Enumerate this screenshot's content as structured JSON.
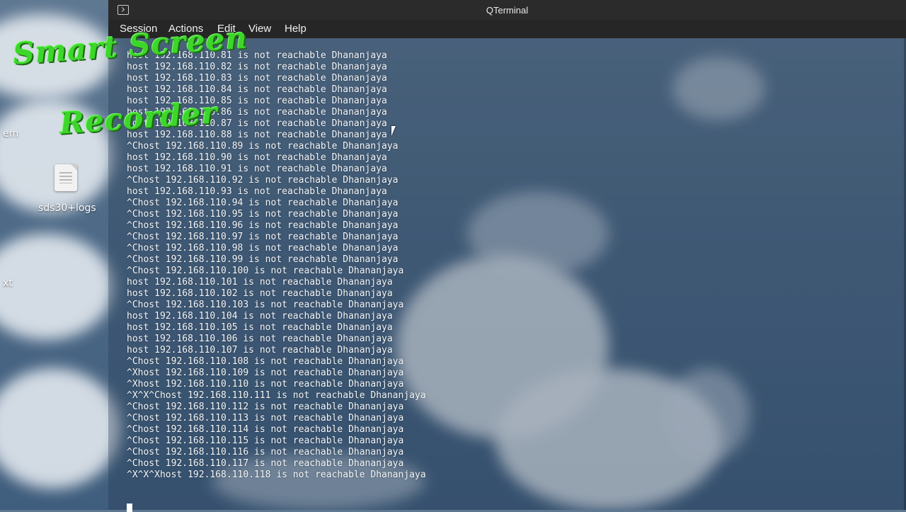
{
  "window": {
    "title": "QTerminal",
    "menu": [
      "Session",
      "Actions",
      "Edit",
      "View",
      "Help"
    ]
  },
  "desktop": {
    "icons": [
      {
        "label": "em",
        "icon": "partial-label"
      },
      {
        "label": "sds30+logs",
        "icon": "text-file-icon"
      },
      {
        "label": "xt",
        "icon": "partial-label"
      }
    ]
  },
  "watermark": {
    "line1": "Smart Screen",
    "line2": "Recorder"
  },
  "terminal": {
    "lines": [
      "host 192.168.110.81 is not reachable Dhananjaya",
      "host 192.168.110.82 is not reachable Dhananjaya",
      "host 192.168.110.83 is not reachable Dhananjaya",
      "host 192.168.110.84 is not reachable Dhananjaya",
      "host 192.168.110.85 is not reachable Dhananjaya",
      "host 192.168.110.86 is not reachable Dhananjaya",
      "host 192.168.110.87 is not reachable Dhananjaya",
      "host 192.168.110.88 is not reachable Dhananjaya",
      "^Chost 192.168.110.89 is not reachable Dhananjaya",
      "host 192.168.110.90 is not reachable Dhananjaya",
      "host 192.168.110.91 is not reachable Dhananjaya",
      "^Chost 192.168.110.92 is not reachable Dhananjaya",
      "host 192.168.110.93 is not reachable Dhananjaya",
      "^Chost 192.168.110.94 is not reachable Dhananjaya",
      "^Chost 192.168.110.95 is not reachable Dhananjaya",
      "^Chost 192.168.110.96 is not reachable Dhananjaya",
      "^Chost 192.168.110.97 is not reachable Dhananjaya",
      "^Chost 192.168.110.98 is not reachable Dhananjaya",
      "^Chost 192.168.110.99 is not reachable Dhananjaya",
      "^Chost 192.168.110.100 is not reachable Dhananjaya",
      "host 192.168.110.101 is not reachable Dhananjaya",
      "host 192.168.110.102 is not reachable Dhananjaya",
      "^Chost 192.168.110.103 is not reachable Dhananjaya",
      "host 192.168.110.104 is not reachable Dhananjaya",
      "host 192.168.110.105 is not reachable Dhananjaya",
      "host 192.168.110.106 is not reachable Dhananjaya",
      "host 192.168.110.107 is not reachable Dhananjaya",
      "^Chost 192.168.110.108 is not reachable Dhananjaya",
      "^Xhost 192.168.110.109 is not reachable Dhananjaya",
      "^Xhost 192.168.110.110 is not reachable Dhananjaya",
      "^X^X^Chost 192.168.110.111 is not reachable Dhananjaya",
      "^Chost 192.168.110.112 is not reachable Dhananjaya",
      "^Chost 192.168.110.113 is not reachable Dhananjaya",
      "^Chost 192.168.110.114 is not reachable Dhananjaya",
      "^Chost 192.168.110.115 is not reachable Dhananjaya",
      "^Chost 192.168.110.116 is not reachable Dhananjaya",
      "^Chost 192.168.110.117 is not reachable Dhananjaya",
      "^X^X^Xhost 192.168.110.118 is not reachable Dhananjaya"
    ]
  }
}
